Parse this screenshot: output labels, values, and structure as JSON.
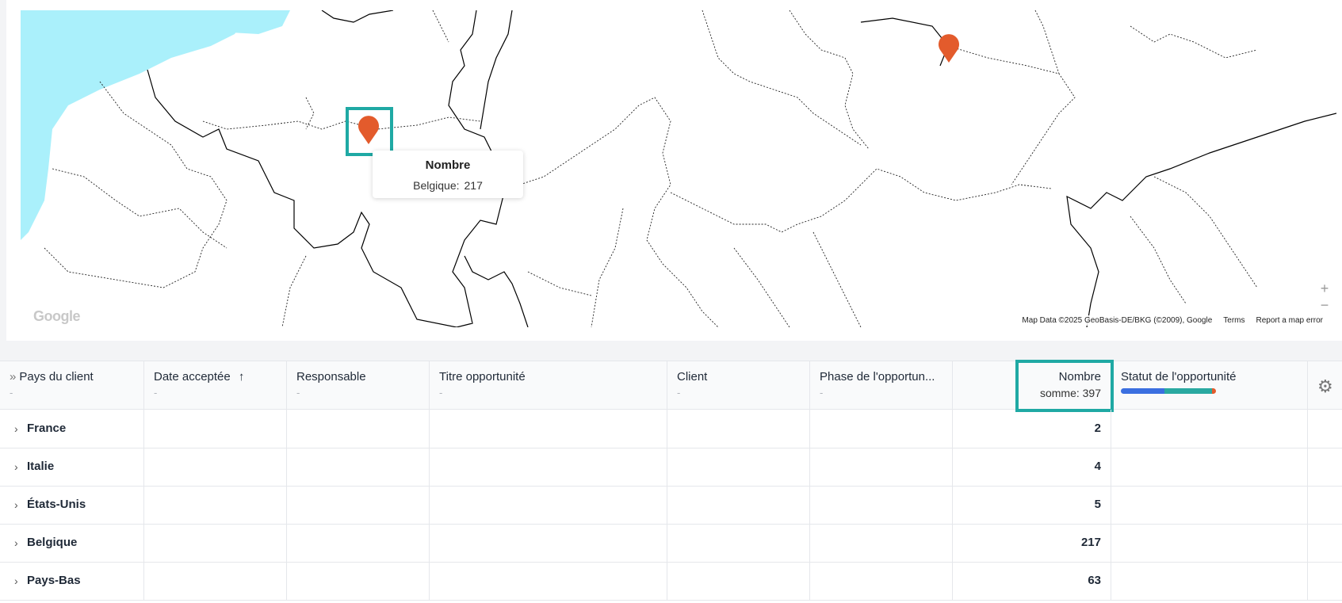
{
  "map": {
    "tooltip": {
      "title": "Nombre",
      "label": "Belgique:",
      "value": "217"
    },
    "google_logo": "Google",
    "footer": {
      "data": "Map Data ©2025 GeoBasis-DE/BKG (©2009), Google",
      "terms": "Terms",
      "report": "Report a map error"
    },
    "zoom_in": "+",
    "zoom_out": "−",
    "marker_color": "#e35b2c",
    "highlight_color": "#1fa9a4"
  },
  "table": {
    "expand_icon": "»",
    "columns": [
      {
        "label": "Pays du client",
        "sub": "-"
      },
      {
        "label": "Date acceptée",
        "sort_icon": "↑",
        "sub": "-"
      },
      {
        "label": "Responsable",
        "sub": "-"
      },
      {
        "label": "Titre opportunité",
        "sub": "-"
      },
      {
        "label": "Client",
        "sub": "-"
      },
      {
        "label": "Phase de l'opportun...",
        "sub": "-"
      },
      {
        "label": "Nombre",
        "sub": "somme: 397"
      },
      {
        "label": "Statut de l'opportunité",
        "status_colors": [
          "#3b6fe0",
          "#2aa9a1",
          "#e35b2c"
        ],
        "status_fractions": [
          0.46,
          0.5,
          0.04
        ]
      }
    ],
    "rows": [
      {
        "country": "France",
        "count": "2"
      },
      {
        "country": "Italie",
        "count": "4"
      },
      {
        "country": "États-Unis",
        "count": "5"
      },
      {
        "country": "Belgique",
        "count": "217"
      },
      {
        "country": "Pays-Bas",
        "count": "63"
      }
    ],
    "chevron": "›",
    "settings_icon": "gear-icon"
  }
}
